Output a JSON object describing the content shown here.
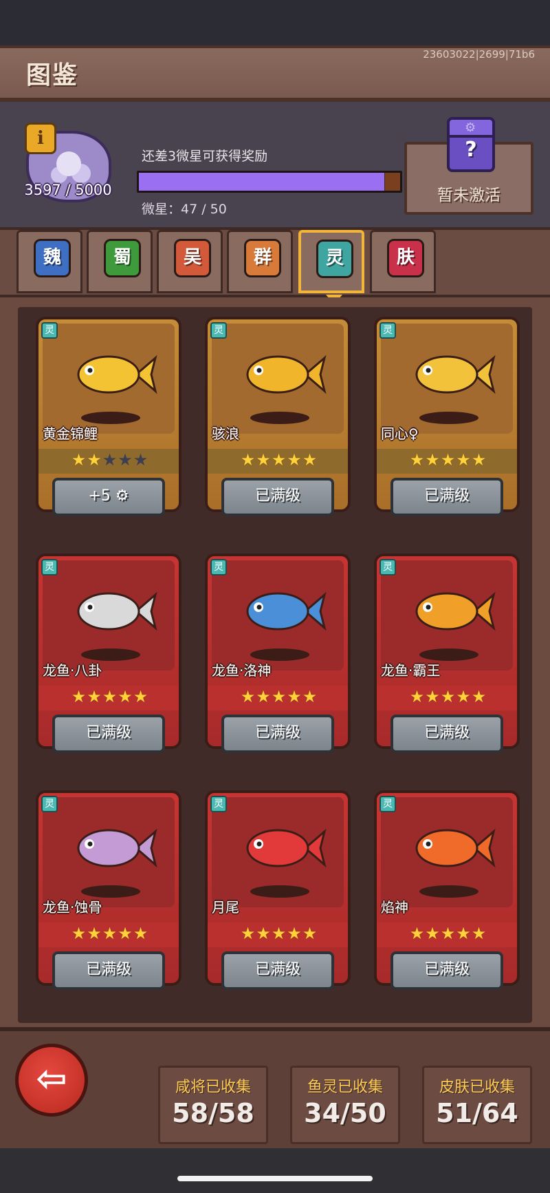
{
  "header": {
    "title": "图鉴",
    "version": "23603022|2699|71b6"
  },
  "star_progress": {
    "count_text": "3597 / 5000",
    "hint": "还差3微星可获得奖励",
    "label": "微星：47 / 50",
    "fill_fraction": 0.94
  },
  "reward": {
    "label": "暂未激活",
    "question": "?"
  },
  "tabs": [
    {
      "label": "魏",
      "color": "#3f6fc3",
      "active": false
    },
    {
      "label": "蜀",
      "color": "#3f9a3c",
      "active": false
    },
    {
      "label": "吴",
      "color": "#d25a3a",
      "active": false
    },
    {
      "label": "群",
      "color": "#d87a3a",
      "active": false
    },
    {
      "label": "灵",
      "color": "#3fa5a0",
      "active": true
    },
    {
      "label": "肤",
      "color": "#c9314a",
      "active": false
    }
  ],
  "cards": [
    {
      "name": "黄金锦鲤",
      "tag": "灵",
      "theme": "gold",
      "stars": 2,
      "max_stars": 5,
      "button": "+5 ⚙",
      "fish_color": "#f3c334"
    },
    {
      "name": "骇浪",
      "tag": "灵",
      "theme": "gold",
      "stars": 5,
      "max_stars": 5,
      "button": "已满级",
      "fish_color": "#f0b52a"
    },
    {
      "name": "同心♀",
      "tag": "灵",
      "theme": "gold",
      "stars": 5,
      "max_stars": 5,
      "button": "已满级",
      "fish_color": "#f2c23a"
    },
    {
      "name": "龙鱼·八卦",
      "tag": "灵",
      "theme": "red",
      "stars": 5,
      "max_stars": 5,
      "button": "已满级",
      "fish_color": "#d9d9d9"
    },
    {
      "name": "龙鱼·洛神",
      "tag": "灵",
      "theme": "red",
      "stars": 5,
      "max_stars": 5,
      "button": "已满级",
      "fish_color": "#4a8fd8"
    },
    {
      "name": "龙鱼·霸王",
      "tag": "灵",
      "theme": "red",
      "stars": 5,
      "max_stars": 5,
      "button": "已满级",
      "fish_color": "#f0a028"
    },
    {
      "name": "龙鱼·蚀骨",
      "tag": "灵",
      "theme": "red",
      "stars": 5,
      "max_stars": 5,
      "button": "已满级",
      "fish_color": "#c59bd6"
    },
    {
      "name": "月尾",
      "tag": "灵",
      "theme": "red",
      "stars": 5,
      "max_stars": 5,
      "button": "已满级",
      "fish_color": "#e23a3a"
    },
    {
      "name": "焰神",
      "tag": "灵",
      "theme": "red",
      "stars": 5,
      "max_stars": 5,
      "button": "已满级",
      "fish_color": "#f06a2a"
    }
  ],
  "footer": {
    "back_icon": "arrow-left",
    "stats": [
      {
        "label": "咸将已收集",
        "value": "58/58"
      },
      {
        "label": "鱼灵已收集",
        "value": "34/50"
      },
      {
        "label": "皮肤已收集",
        "value": "51/64"
      }
    ]
  }
}
